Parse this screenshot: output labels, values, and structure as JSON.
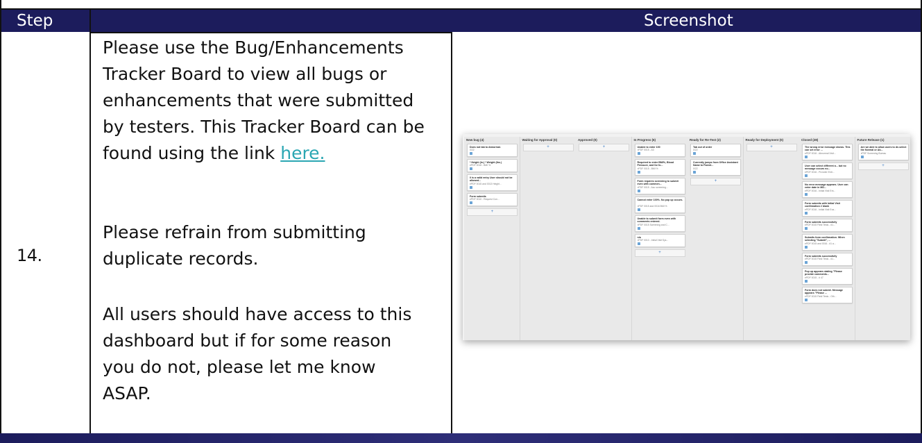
{
  "table": {
    "header": {
      "step": "Step",
      "screenshot": "Screenshot"
    },
    "row": {
      "step_number": "14.",
      "paragraph1": "Please use the Bug/Enhancements Tracker Board to view all bugs or enhancements that were submitted by testers. This Tracker Board can be found using the link ",
      "link_text": "here.",
      "paragraph2": "Please refrain from submitting duplicate records.",
      "paragraph3": "All users should have access to this dashboard but if for some reason you do not, please let me know ASAP."
    }
  },
  "colors": {
    "header_bg": "#1c1c5c",
    "link": "#2aa6b2",
    "border": "#111111"
  },
  "tracker_board": {
    "columns": [
      {
        "title": "New bug (4)",
        "cards": [
          {
            "title": "Does not tab to Abnormal.",
            "sub": "0/22"
          },
          {
            "title": "* Height (in.) * Weight (lbs.)",
            "sub": "ePDF 0016 - BMI %"
          },
          {
            "title": "0 is a valid entry User should not be allowed...",
            "sub": "ePDF 0015 and 0013 Height..."
          },
          {
            "title": "Form submits",
            "sub": "ePDF 0010 - Request Con..."
          }
        ],
        "add": "+"
      },
      {
        "title": "Waiting for Approval (0)",
        "cards": [],
        "add": "+"
      },
      {
        "title": "Approved (0)",
        "cards": [],
        "add": "+"
      },
      {
        "title": "In Progress (6)",
        "cards": [
          {
            "title": "Unable to enter 100",
            "sub": "ePDF 0015 - A3"
          },
          {
            "title": "Required to enter BMI%, Blood Pressure, and for fo...",
            "sub": "ePDF 0015 - BMI %"
          },
          {
            "title": "Form requires screening to submit even with commen...",
            "sub": "ePDF 0015 - Acu screening..."
          },
          {
            "title": "Cannot enter 100%. No pop up occurs.",
            "sub": "ePDF 0015 and 0016 BMI %"
          },
          {
            "title": "Unable to submit form even with comments entered.",
            "sub": "ePDF 0015 Screening and C..."
          },
          {
            "title": "n/a",
            "sub": "ePDF 0010 - Initial Visit Sys..."
          }
        ],
        "add": "+"
      },
      {
        "title": "Ready for Re-Test (2)",
        "cards": [
          {
            "title": "Tab out of order",
            "sub": "0/22"
          },
          {
            "title": "Currently jumps from Office Assistant Name to Parent...",
            "sub": "0/22"
          }
        ],
        "add": "+"
      },
      {
        "title": "Ready for Deployment (0)",
        "cards": [],
        "add": "+"
      },
      {
        "title": "Closed (28)",
        "cards": [
          {
            "title": "The wrong error message shows. This can set error ...",
            "sub": "ePDF 0016 - Abnormal Visit..."
          },
          {
            "title": "User can select different a... but no message occurs no...",
            "sub": "ePDF 0016 - Provider Entr..."
          },
          {
            "title": "No error message appears. User can enter date in MD...",
            "sub": "ePDF 0016 - Initial Visit Ent..."
          },
          {
            "title": "Form submits with Initial Visit confirmation # blank",
            "sub": "ePDF 0016 - Initial Visit Exa..."
          },
          {
            "title": "Form submits successfully",
            "sub": "ePDF 0015 Field Tests - #1..."
          },
          {
            "title": "Submits form confirmation. When selecting \"Submit\", ...",
            "sub": "ePDF 0015 and 0016 - #1 a..."
          },
          {
            "title": "Form submits successfully",
            "sub": "ePDF 0015 Field Tests - #1..."
          },
          {
            "title": "Pop up appears stating \"Please provide comments...",
            "sub": "ePDF 0015 - # 47"
          },
          {
            "title": "Form does not submit. Message appears \"Please ...",
            "sub": "ePDF 0015 Field Tests - Oth..."
          }
        ],
        "add": ""
      },
      {
        "title": "Future Release (1)",
        "cards": [
          {
            "title": "Are we able to allow users to de-select the Normal or Ab...",
            "sub": "ePDF Screening Bureau"
          }
        ],
        "add": "+"
      }
    ]
  }
}
